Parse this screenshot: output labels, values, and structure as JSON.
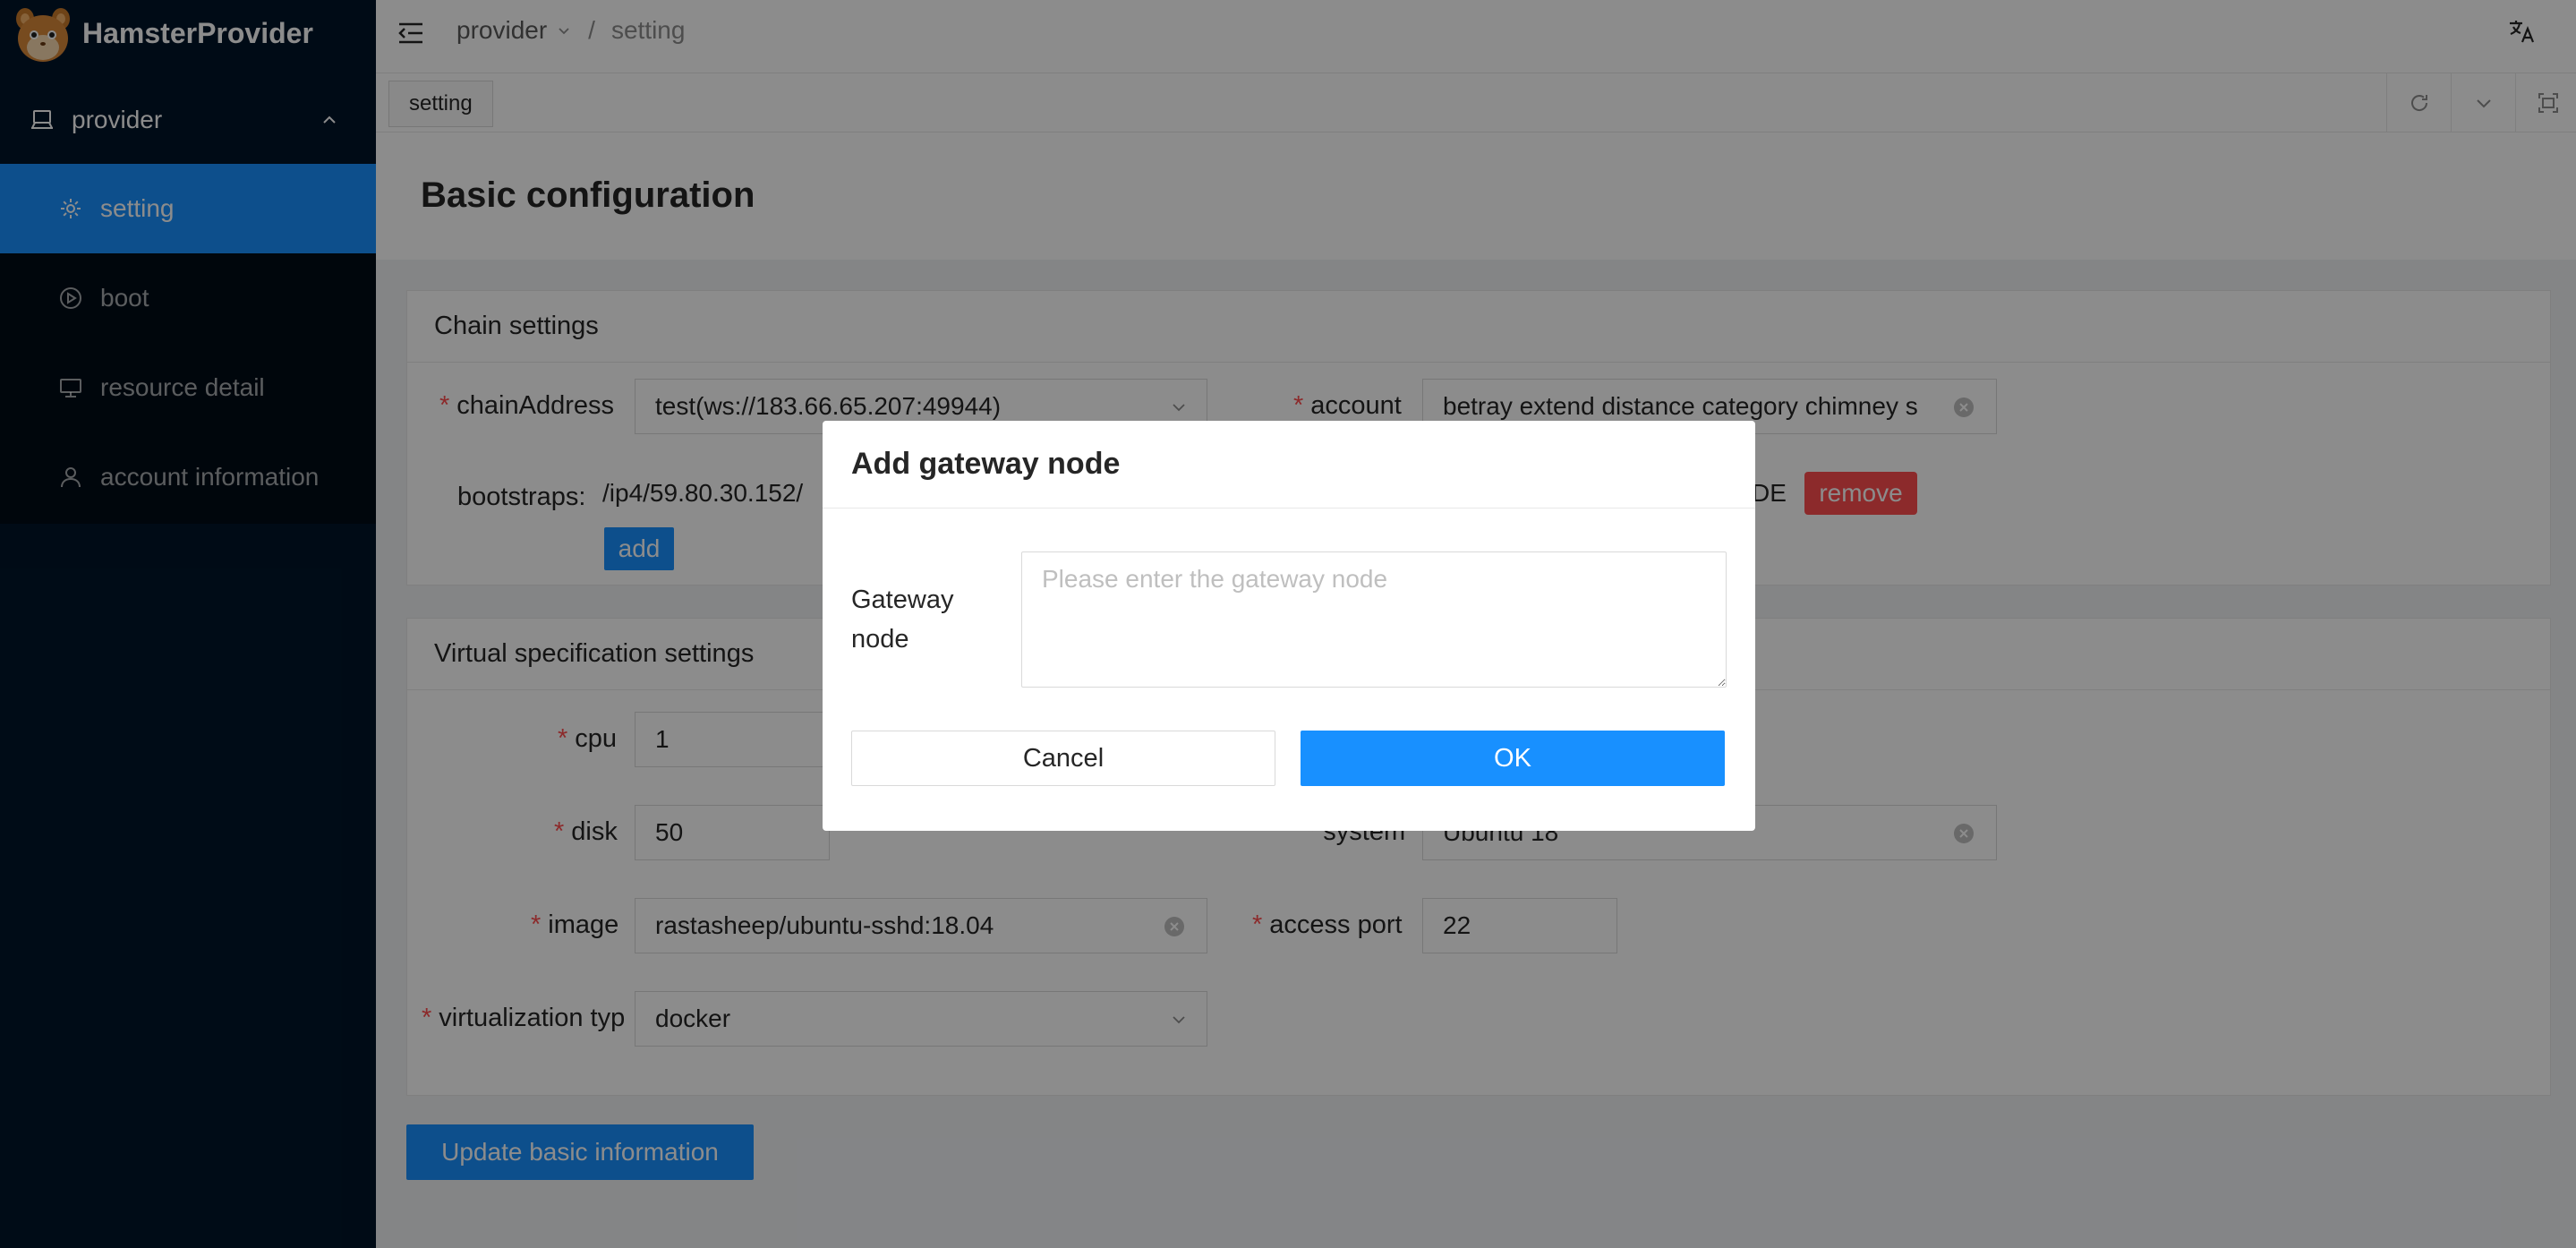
{
  "app": {
    "name": "HamsterProvider"
  },
  "sidebar": {
    "group": {
      "label": "provider",
      "icon": "laptop-icon",
      "expanded": true
    },
    "items": [
      {
        "label": "setting",
        "icon": "gear-icon",
        "active": true
      },
      {
        "label": "boot",
        "icon": "play-circle-icon",
        "active": false
      },
      {
        "label": "resource detail",
        "icon": "monitor-icon",
        "active": false
      },
      {
        "label": "account information",
        "icon": "user-icon",
        "active": false
      }
    ]
  },
  "header": {
    "breadcrumb": {
      "parent": "provider",
      "separator": "/",
      "current": "setting"
    }
  },
  "tabs": [
    {
      "label": "setting"
    }
  ],
  "page": {
    "title": "Basic configuration",
    "chain": {
      "title": "Chain settings",
      "chainAddress": {
        "label": "chainAddress",
        "value": "test(ws://183.66.65.207:49944)"
      },
      "account": {
        "label": "account",
        "value": "betray extend distance category chimney s"
      },
      "bootstraps": {
        "label": "bootstraps:",
        "value_visible": "/ip4/59.80.30.152/",
        "value_tail": "DE",
        "remove_label": "remove",
        "add_label": "add"
      }
    },
    "virtual": {
      "title": "Virtual specification settings",
      "cpu": {
        "label": "cpu",
        "value": "1"
      },
      "disk": {
        "label": "disk",
        "value": "50"
      },
      "system": {
        "label": "system",
        "value": "Ubuntu 18"
      },
      "image": {
        "label": "image",
        "value": "rastasheep/ubuntu-sshd:18.04"
      },
      "access_port": {
        "label": "access port",
        "value": "22"
      },
      "virtualization_type": {
        "label": "virtualization typ",
        "value": "docker"
      }
    },
    "update_button": "Update basic information"
  },
  "modal": {
    "title": "Add gateway node",
    "field_label": "Gateway node",
    "placeholder": "Please enter the gateway node",
    "value": "",
    "cancel": "Cancel",
    "ok": "OK"
  },
  "colors": {
    "primary": "#1890ff",
    "sidebar_bg": "#001529",
    "danger": "#ff4d4f",
    "required": "#ff4d4f"
  }
}
